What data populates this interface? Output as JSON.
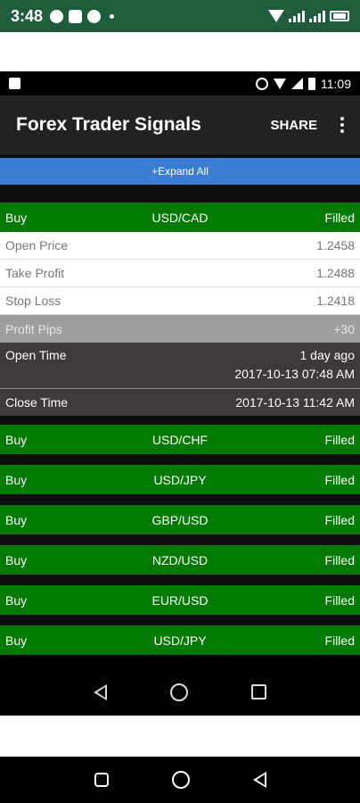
{
  "outer_status": {
    "time": "3:48",
    "icons": [
      "telegram-icon",
      "message-icon",
      "app-icon"
    ],
    "right_icons": [
      "wifi-icon",
      "signal-icon",
      "battery-icon"
    ]
  },
  "inner_status": {
    "time": "11:09",
    "icons": [
      "notification-icon",
      "alarm-icon",
      "wifi-icon",
      "signal-icon",
      "battery-icon"
    ]
  },
  "appbar": {
    "title": "Forex Trader Signals",
    "share_label": "SHARE",
    "menu_icon": "more-vert-icon"
  },
  "expand_all_label": "+Expand All",
  "expanded_signal": {
    "action": "Buy",
    "pair": "USD/CAD",
    "status": "Filled",
    "open_price_label": "Open Price",
    "open_price": "1.2458",
    "take_profit_label": "Take Profit",
    "take_profit": "1.2488",
    "stop_loss_label": "Stop Loss",
    "stop_loss": "1.2418",
    "profit_pips_label": "Profit Pips",
    "profit_pips": "+30",
    "open_time_label": "Open Time",
    "open_time_relative": "1 day ago",
    "open_time": "2017-10-13 07:48 AM",
    "close_time_label": "Close Time",
    "close_time": "2017-10-13 11:42 AM"
  },
  "signals": [
    {
      "action": "Buy",
      "pair": "USD/CHF",
      "status": "Filled"
    },
    {
      "action": "Buy",
      "pair": "USD/JPY",
      "status": "Filled"
    },
    {
      "action": "Buy",
      "pair": "GBP/USD",
      "status": "Filled"
    },
    {
      "action": "Buy",
      "pair": "NZD/USD",
      "status": "Filled"
    },
    {
      "action": "Buy",
      "pair": "EUR/USD",
      "status": "Filled"
    },
    {
      "action": "Buy",
      "pair": "USD/JPY",
      "status": "Filled"
    }
  ],
  "colors": {
    "green": "#007a00",
    "blue": "#3b7dd0",
    "appbar": "#222222",
    "outer_status": "#1f5c3c"
  }
}
